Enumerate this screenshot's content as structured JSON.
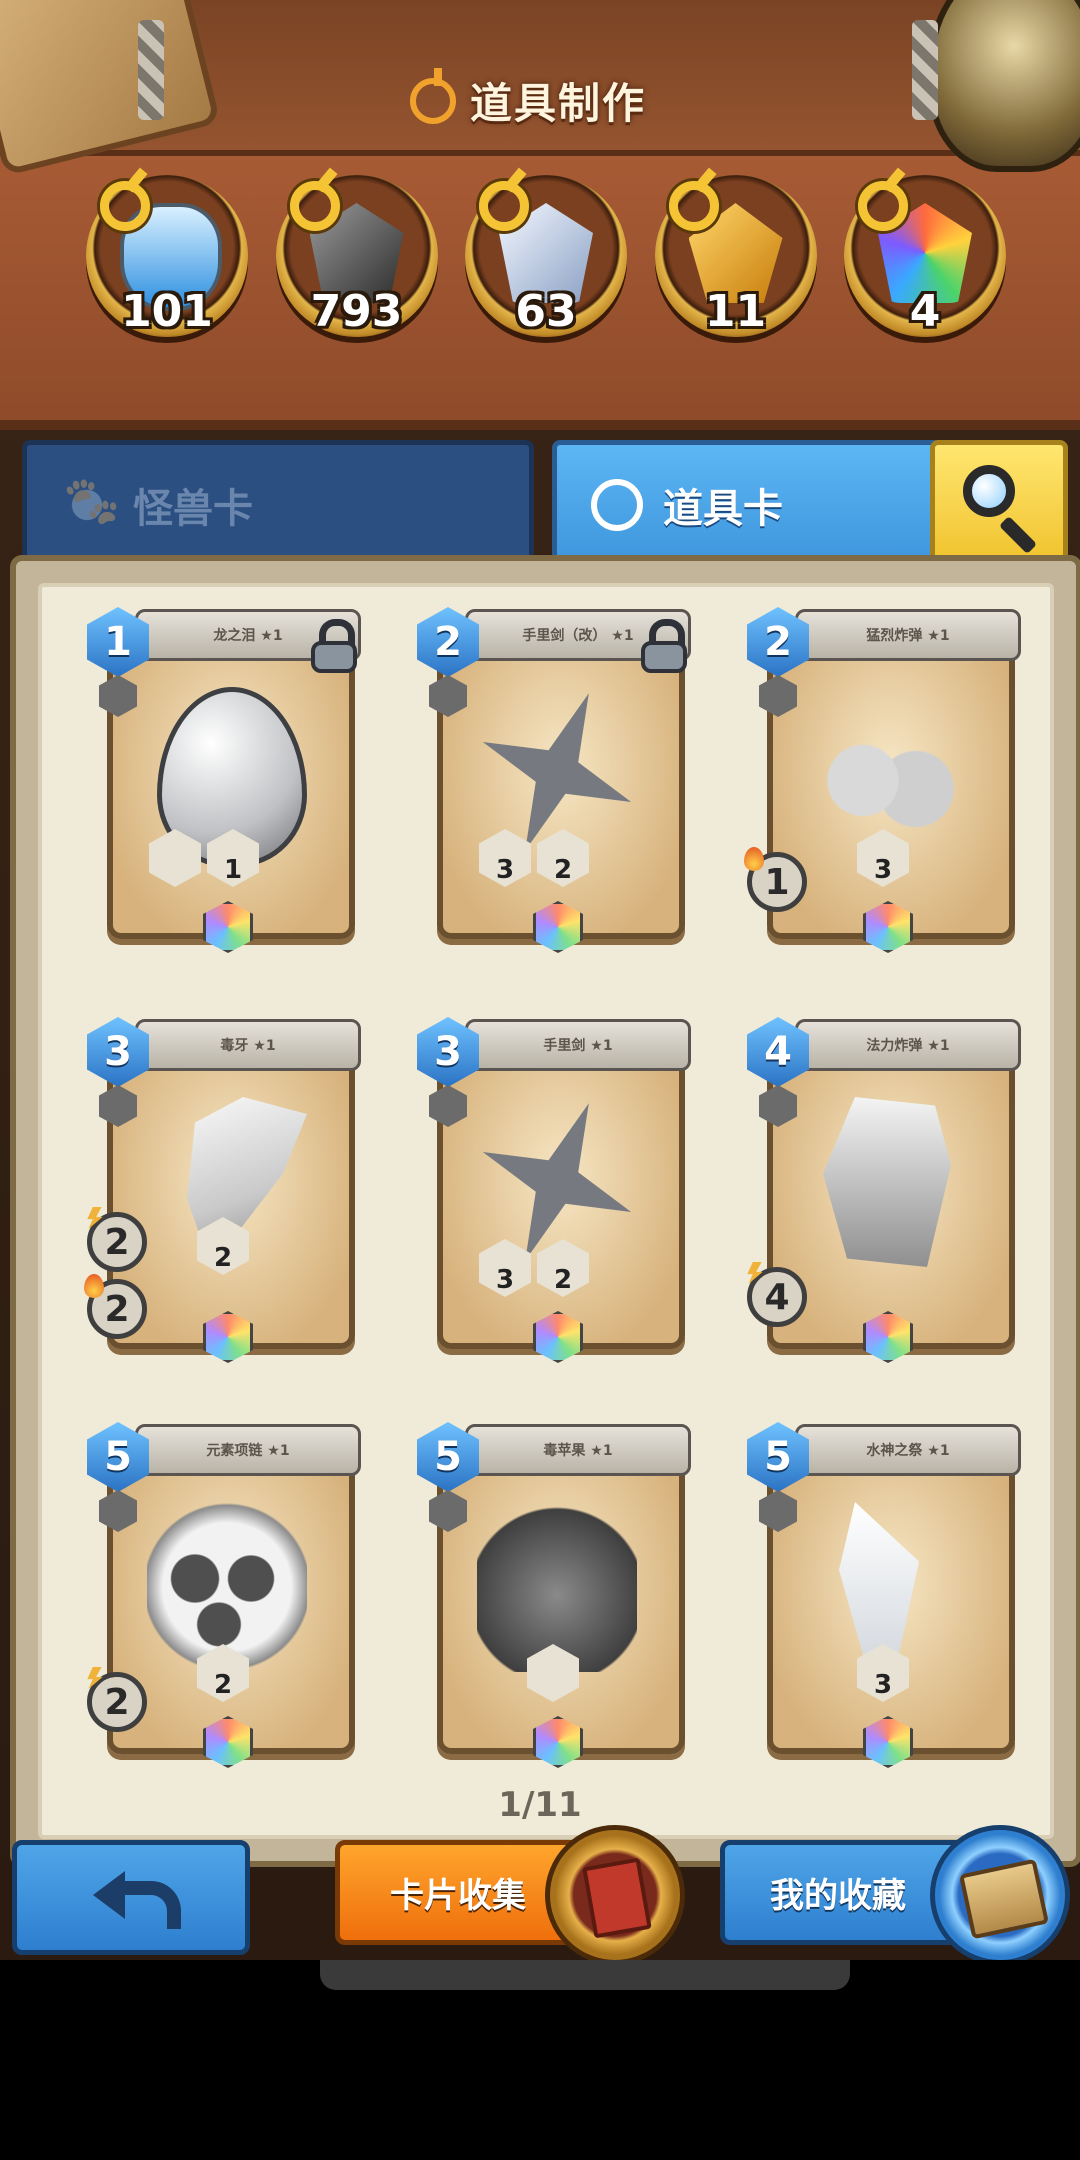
{
  "header": {
    "title": "道具制作"
  },
  "resources": [
    {
      "icon": "potion-bottle",
      "count": "101"
    },
    {
      "icon": "dark-crystal",
      "count": "793"
    },
    {
      "icon": "silver-crystal",
      "count": "63"
    },
    {
      "icon": "gold-crystal",
      "count": "11"
    },
    {
      "icon": "rainbow-crystal",
      "count": "4"
    }
  ],
  "tabs": {
    "monster": "怪兽卡",
    "item": "道具卡"
  },
  "cards": [
    {
      "level": "1",
      "name": "龙之泪 ★1",
      "art": "egg",
      "locked": true,
      "stats": [
        "",
        "1"
      ]
    },
    {
      "level": "2",
      "name": "手里剑（改） ★1",
      "art": "shuriken",
      "locked": true,
      "stats": [
        "3",
        "2"
      ]
    },
    {
      "level": "2",
      "name": "猛烈炸弹 ★1",
      "art": "bomb",
      "locked": false,
      "stats": [
        "3"
      ],
      "side": [
        "1"
      ]
    },
    {
      "level": "3",
      "name": "毒牙 ★1",
      "art": "fang",
      "locked": false,
      "stats": [
        "2"
      ],
      "side": [
        "2",
        "2"
      ]
    },
    {
      "level": "3",
      "name": "手里剑 ★1",
      "art": "shuriken",
      "locked": false,
      "stats": [
        "3",
        "2"
      ]
    },
    {
      "level": "4",
      "name": "法力炸弹 ★1",
      "art": "fist",
      "locked": false,
      "stats": [],
      "side": [
        "4"
      ]
    },
    {
      "level": "5",
      "name": "元素项链 ★1",
      "art": "amulet",
      "locked": false,
      "stats": [
        "2"
      ],
      "side": [
        "2"
      ]
    },
    {
      "level": "5",
      "name": "毒苹果 ★1",
      "art": "apple",
      "locked": false,
      "stats": [
        ""
      ]
    },
    {
      "level": "5",
      "name": "水神之祭 ★1",
      "art": "crystal",
      "locked": false,
      "stats": [
        "3"
      ]
    }
  ],
  "pagination": "1/11",
  "bottom": {
    "collect": "卡片收集",
    "mine": "我的收藏"
  }
}
